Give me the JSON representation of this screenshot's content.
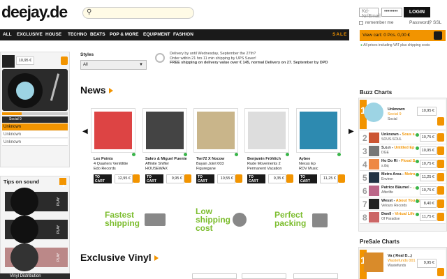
{
  "header": {
    "logo": "deejay.de",
    "login_placeholder": "Kd-Nr/Email",
    "password_mask": "••••••••",
    "login_label": "LOGIN",
    "remember": "remember me",
    "password_link": "Password?",
    "ssl": "SSL"
  },
  "nav": [
    "ALL",
    "EXCLUSIVE",
    "HOUSE",
    "TECHNO",
    "BEATS",
    "POP & MORE",
    "EQUIPMENT",
    "FASHION"
  ],
  "sale": "SALE",
  "cart": {
    "label": "View cart: 0 Pcs. 0,00 €",
    "note": "All prices including VAT plus shipping costs"
  },
  "player": {
    "price": "10,95 €",
    "track": "Social 9",
    "items": [
      "Unknown",
      "Unknown",
      "Unknown"
    ]
  },
  "styles": {
    "label": "Styles",
    "value": "All"
  },
  "delivery": {
    "line1": "Delivery by until Wednesday, September the 27th?",
    "line2": "Order within 21 hrs 11 min shipping by UPS Saver!",
    "line3": "FREE shipping on delivery value over € 145, normal Delivery on 27. September by DPD"
  },
  "news": {
    "title": "News",
    "products": [
      {
        "artist": "Lex Points",
        "title": "4 Quarters Venitilitie",
        "label": "Edo Records",
        "price": "12,95 €"
      },
      {
        "artist": "Sakro & Miguel Puente",
        "title": "Affinite Shifter",
        "label": "HOUSEWAX",
        "price": "9,95 €"
      },
      {
        "artist": "Twr72 X Nocow",
        "title": "Bayan Joint 003",
        "label": "Figuregane",
        "price": "10,55 €"
      },
      {
        "artist": "Benjamin Fröhlich",
        "title": "Rude Movements 2",
        "label": "Permanent Vacation",
        "price": "9,35 €"
      },
      {
        "artist": "Aybee",
        "title": "Nexus Ep",
        "label": "RDV Music",
        "price": "11,25 €"
      }
    ],
    "cart_btn": "TO CART"
  },
  "features": [
    "Fastest shipping",
    "Low shipping cost",
    "Perfect packing"
  ],
  "exclusive": {
    "title": "Exclusive Vinyl"
  },
  "tips": {
    "title": "Tips on sound",
    "play": "PLAY"
  },
  "vinyl_dist": "Vinyl Distribution",
  "buzz": {
    "title": "Buzz Charts",
    "rows": [
      {
        "rank": "1",
        "artist": "Unknown",
        "title": "Social 9",
        "label": "Social",
        "price": "10,95 €"
      },
      {
        "rank": "2",
        "artist": "Unknown",
        "title": "Sous s...",
        "label": "SOUS.SOUL",
        "price": "10,75 €"
      },
      {
        "rank": "3",
        "artist": "S.o.n",
        "title": "Untitled Ep",
        "label": "DGE",
        "price": "10,95 €"
      },
      {
        "rank": "4",
        "artist": "Ho Do Ri",
        "title": "Flood S...",
        "label": "s.ibq",
        "price": "10,75 €"
      },
      {
        "rank": "5",
        "artist": "Metro Area",
        "title": "Metro ...",
        "label": "Environ",
        "price": "11,25 €"
      },
      {
        "rank": "6",
        "artist": "Patrice Bäumel",
        "title": "...",
        "label": "Afterlife",
        "price": "10,75 €"
      },
      {
        "rank": "7",
        "artist": "Wesst",
        "title": "About You Ep",
        "label": "Velours Records",
        "price": "8,40 €"
      },
      {
        "rank": "8",
        "artist": "Dwell",
        "title": "Virtual Life",
        "label": "Of Paradise",
        "price": "11,75 €"
      }
    ]
  },
  "presale": {
    "title": "PreSale Charts",
    "row": {
      "rank": "1",
      "artist": "Va ( Real D...)",
      "title": "Wastefunds 001",
      "label": "Wastefunds",
      "price": "9,95 €"
    }
  },
  "colors": {
    "accent": "#f29400",
    "nav": "#1a1a1a",
    "green": "#7cbd2e"
  }
}
